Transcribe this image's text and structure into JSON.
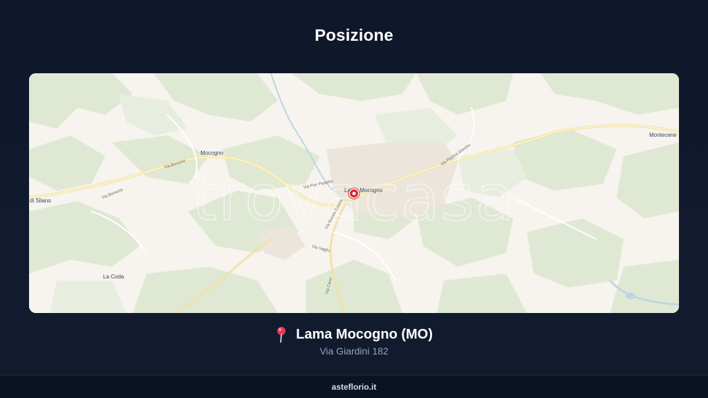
{
  "header": {
    "title": "Posizione"
  },
  "map": {
    "watermark": "trovacasa",
    "marker_icon": "location-marker-icon",
    "places": {
      "lama_mocogno": "Lama Mocogno",
      "mocogno": "Mocogno",
      "silano": "di Silano",
      "la_coda": "La Coda",
      "montecenere": "Montecene"
    },
    "roads": {
      "via_borsone_1": "Via Borsone",
      "via_borsone_2": "Via Borsone",
      "via_pier_paolo": "Via Pier Pasolini",
      "via_piastra_giardini": "Via Piastra Giardini",
      "via_nuova": "Via Nuova Cucina",
      "via_vaglio": "Via Vaglio",
      "via_cervi": "Via Cervi"
    }
  },
  "location": {
    "pin_icon": "pin-icon",
    "name": "Lama Mocogno (MO)",
    "address": "Via Giardini 182"
  },
  "footer": {
    "brand": "asteflorio.it"
  }
}
